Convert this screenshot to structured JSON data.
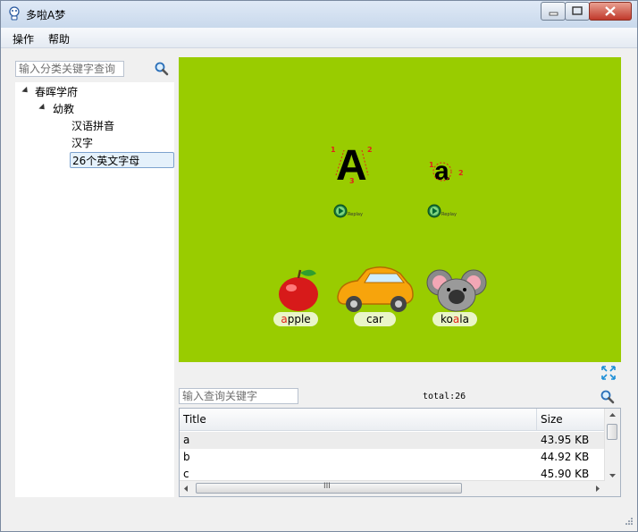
{
  "window": {
    "title": "多啦A梦",
    "controls": [
      "minimize-icon",
      "maximize-icon",
      "close-icon"
    ]
  },
  "menu": {
    "items": [
      {
        "label": "操作"
      },
      {
        "label": "帮助"
      }
    ]
  },
  "sidebar": {
    "search_placeholder": "输入分类关键字查询",
    "search_icon": "search-icon",
    "tree": [
      {
        "label": "春晖学府",
        "expanded": true
      },
      {
        "label": "幼教",
        "expanded": true
      },
      {
        "label": "汉语拼音"
      },
      {
        "label": "汉字"
      },
      {
        "label": "26个英文字母",
        "selected": true
      }
    ]
  },
  "preview": {
    "background": "#99cc00",
    "letters": [
      "A",
      "a"
    ],
    "stroke_numbers_upper": [
      "1",
      "2",
      "3"
    ],
    "stroke_numbers_lower": [
      "1",
      "2"
    ],
    "replay_label": "Replay",
    "words": [
      {
        "prefix": "",
        "highlight": "a",
        "rest": "pple"
      },
      {
        "prefix": "",
        "highlight": "",
        "rest": "car"
      },
      {
        "prefix": "ko",
        "highlight": "a",
        "rest": "la"
      }
    ],
    "fullscreen_icon": "fullscreen-icon"
  },
  "list": {
    "search_placeholder": "输入查询关键字",
    "total_label": "total:26",
    "search_icon": "search-icon",
    "columns": [
      "Title",
      "Size"
    ],
    "rows": [
      {
        "title": "a",
        "size": "43.95 KB",
        "selected": true
      },
      {
        "title": "b",
        "size": "44.92 KB"
      },
      {
        "title": "c",
        "size": "45.90 KB"
      }
    ],
    "hscroll_grip": "III"
  },
  "colors": {
    "preview_bg": "#99cc00",
    "accent_red": "#e2231a",
    "selection": "#e5f1fb"
  }
}
